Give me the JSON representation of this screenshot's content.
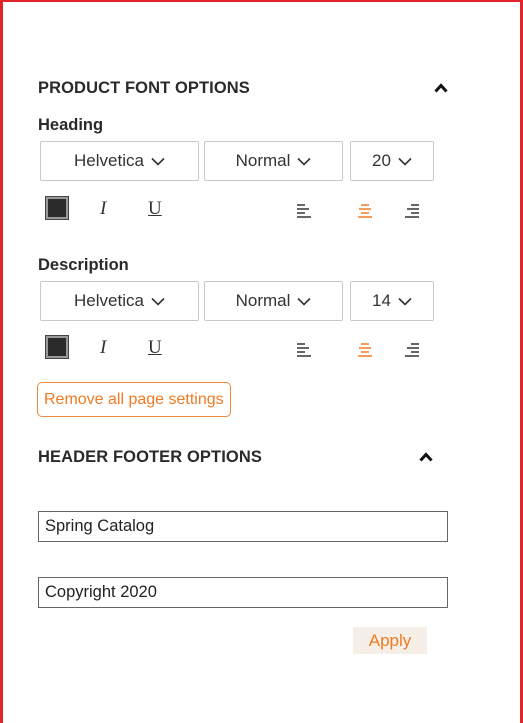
{
  "product_font_options": {
    "title": "PRODUCT FONT OPTIONS",
    "collapse_icon": "chevron-up-icon",
    "heading": {
      "label": "Heading",
      "font_family": "Helvetica",
      "font_weight": "Normal",
      "font_size": "20",
      "color_swatch": "#2b2b2b",
      "italic_label": "I",
      "underline_label": "U",
      "selected_alignment": "center"
    },
    "description": {
      "label": "Description",
      "font_family": "Helvetica",
      "font_weight": "Normal",
      "font_size": "14",
      "color_swatch": "#2b2b2b",
      "italic_label": "I",
      "underline_label": "U",
      "selected_alignment": "center"
    },
    "remove_button_label": "Remove all page settings"
  },
  "header_footer_options": {
    "title": "HEADER FOOTER OPTIONS",
    "collapse_icon": "chevron-up-icon",
    "header_value": "Spring Catalog",
    "footer_value": "Copyright 2020",
    "apply_label": "Apply"
  },
  "colors": {
    "accent": "#f07a22",
    "frame_border": "#e0242a",
    "text": "#222222"
  }
}
